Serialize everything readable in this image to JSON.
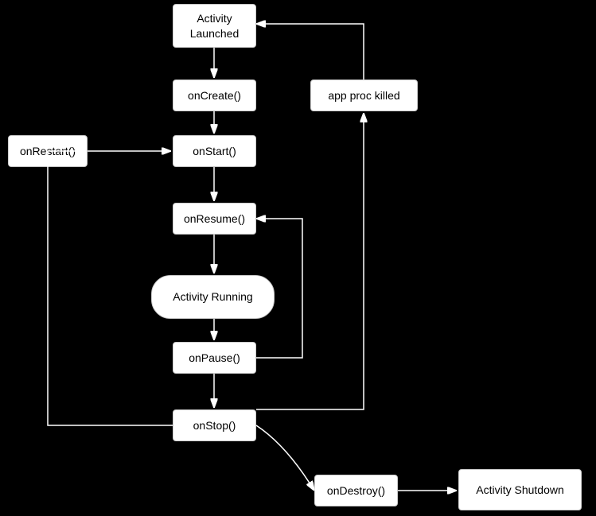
{
  "nodes": {
    "activity_launched": {
      "label": "Activity\nLaunched"
    },
    "on_create": {
      "label": "onCreate()"
    },
    "app_proc_killed": {
      "label": "app proc killed"
    },
    "on_restart": {
      "label": "onRestart()"
    },
    "on_start": {
      "label": "onStart()"
    },
    "on_resume": {
      "label": "onResume()"
    },
    "activity_running": {
      "label": "Activity Running"
    },
    "on_pause": {
      "label": "onPause()"
    },
    "on_stop": {
      "label": "onStop()"
    },
    "on_destroy": {
      "label": "onDestroy()"
    },
    "activity_shutdown": {
      "label": "Activity Shutdown"
    }
  }
}
